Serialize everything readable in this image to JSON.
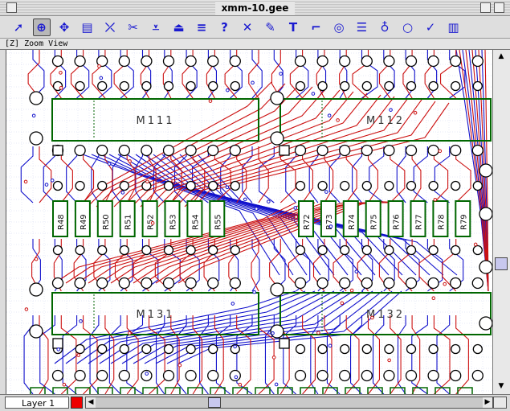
{
  "window": {
    "title": "xmm-10.gee"
  },
  "view": {
    "label": "[Z] Zoom View"
  },
  "toolbar": {
    "tools": [
      {
        "icon": "pointer-icon",
        "glyph": "➚"
      },
      {
        "icon": "zoom-icon",
        "glyph": "⊕",
        "active": true
      },
      {
        "icon": "pan-icon",
        "glyph": "✥"
      },
      {
        "icon": "component-icon",
        "glyph": "▤"
      },
      {
        "icon": "route-icon",
        "glyph": "⤫"
      },
      {
        "icon": "cut-icon",
        "glyph": "✂"
      },
      {
        "icon": "via-icon",
        "glyph": "⩡"
      },
      {
        "icon": "pad-icon",
        "glyph": "⏏"
      },
      {
        "icon": "bus-icon",
        "glyph": "≡"
      },
      {
        "icon": "help-icon",
        "glyph": "?"
      },
      {
        "icon": "delete-icon",
        "glyph": "✕"
      },
      {
        "icon": "pencil-icon",
        "glyph": "✎"
      },
      {
        "icon": "text-icon",
        "glyph": "T"
      },
      {
        "icon": "corner-icon",
        "glyph": "⌐"
      },
      {
        "icon": "target-icon",
        "glyph": "◎"
      },
      {
        "icon": "align-icon",
        "glyph": "☰"
      },
      {
        "icon": "pin-icon",
        "glyph": "♁"
      },
      {
        "icon": "ring-icon",
        "glyph": "○"
      },
      {
        "icon": "check-icon",
        "glyph": "✓"
      },
      {
        "icon": "chip-icon",
        "glyph": "▥"
      }
    ]
  },
  "board": {
    "ics": [
      "M111",
      "M112",
      "M131",
      "M132"
    ],
    "resistors_left": [
      "R48",
      "R49",
      "R50",
      "R51",
      "R52",
      "R53",
      "R54",
      "R55"
    ],
    "resistors_right": [
      "R72",
      "R73",
      "R74",
      "R75",
      "R76",
      "R77",
      "R78",
      "R79"
    ],
    "colors": {
      "trace_top": "#cc1111",
      "trace_bottom": "#1111cc",
      "outline": "#006600",
      "pad": "#000000"
    }
  },
  "status": {
    "layer_label": "Layer 1",
    "layer_color": "#ee0000"
  }
}
